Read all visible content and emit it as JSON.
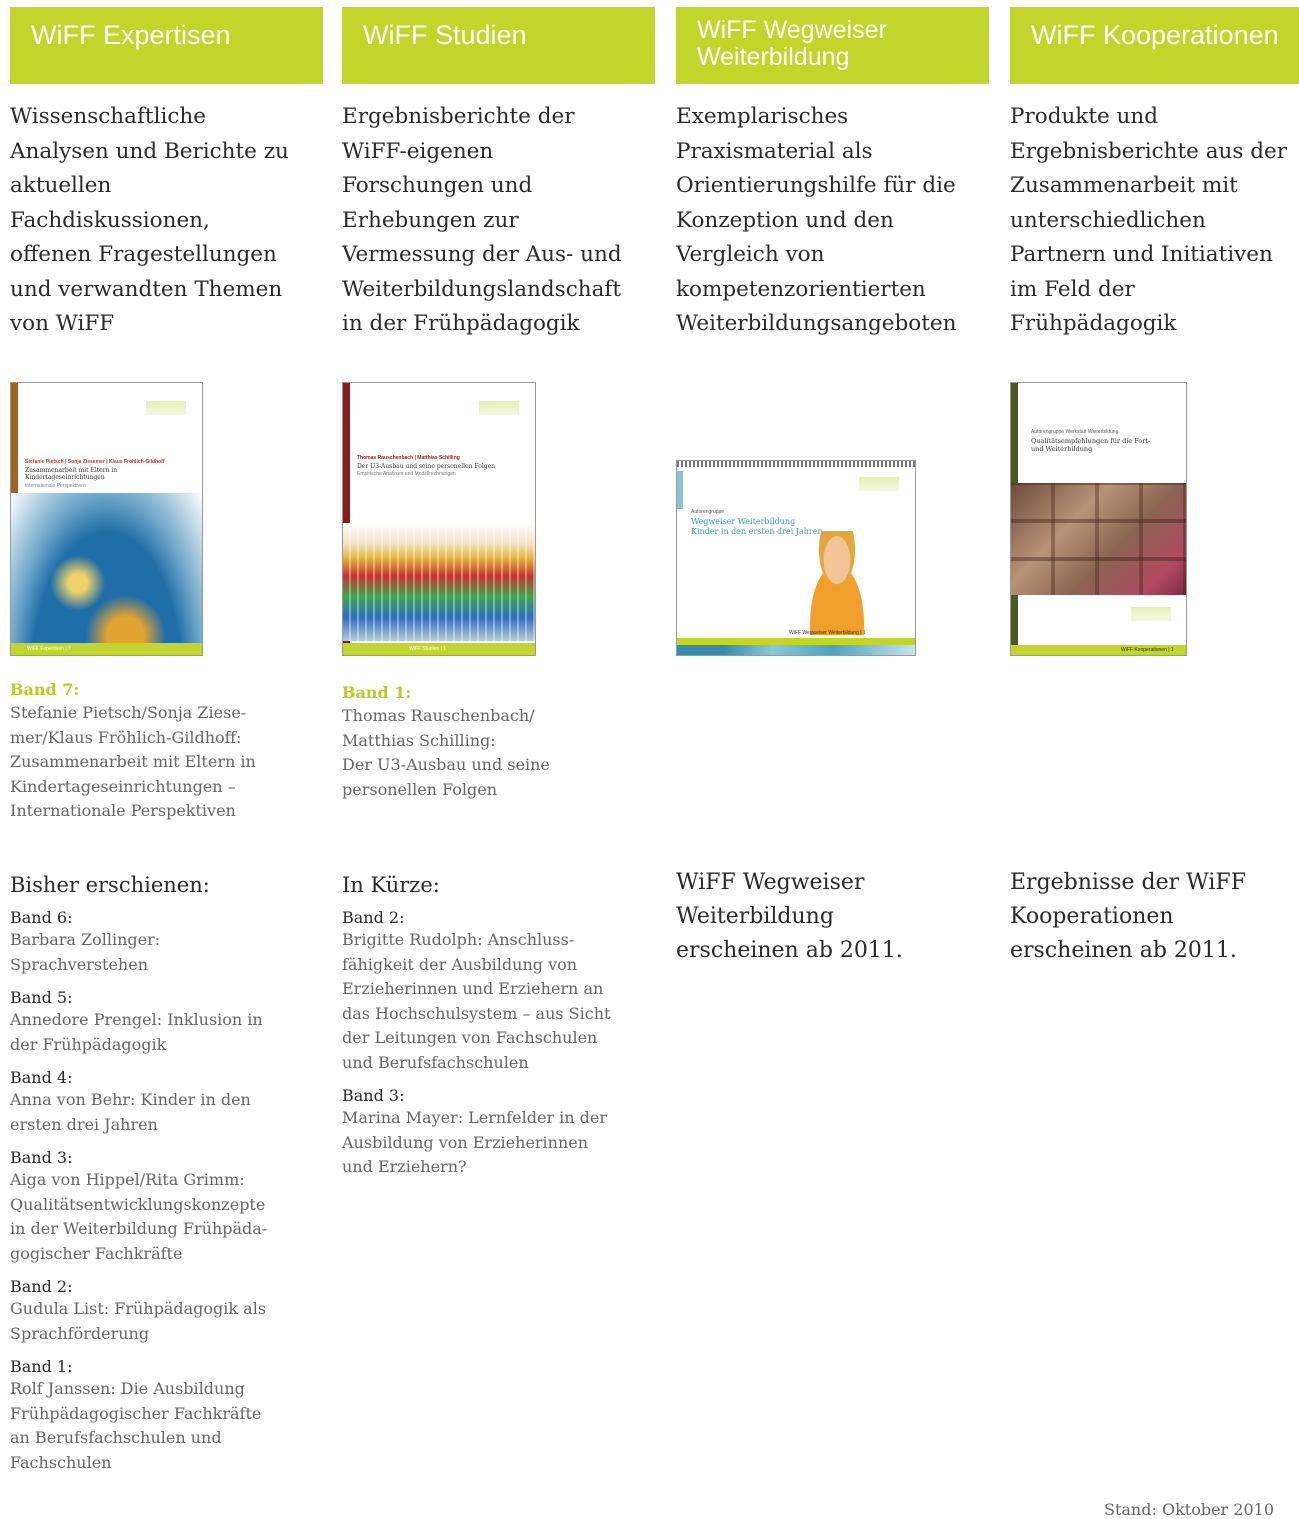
{
  "columns": [
    {
      "header": "WiFF Expertisen",
      "intro": "Wissenschaftliche Analysen und Berichte zu aktuellen Fachdiskussionen, offenen Fragestellungen und verwandten Themen von WiFF",
      "cover": {
        "authors": "Stefanie Pietsch | Sonja Ziesemer | Klaus Fröhlich-Gildhoff",
        "title": "Zusammenarbeit mit Eltern in Kindertageseinrichtungen",
        "subtitle": "Internationale Perspektiven",
        "footer": "WiFF Expertisen | 7"
      },
      "featured": {
        "band": "Band 7:",
        "lines": [
          "Stefanie Pietsch/Sonja Ziese-",
          "mer/Klaus Fröhlich-Gildhoff:",
          "Zusammenarbeit mit Eltern in",
          "Kindertageseinrichtungen –",
          "Internationale Perspektiven"
        ]
      },
      "section_title": "Bisher erschienen:",
      "list": [
        {
          "band": "Band 6:",
          "lines": [
            "Barbara Zollinger:",
            "Sprachverstehen"
          ]
        },
        {
          "band": "Band 5:",
          "lines": [
            "Annedore Prengel: Inklusion in",
            "der Frühpädagogik"
          ]
        },
        {
          "band": "Band 4:",
          "lines": [
            "Anna von Behr: Kinder in den",
            "ersten drei Jahren"
          ]
        },
        {
          "band": "Band 3:",
          "lines": [
            "Aiga von Hippel/Rita Grimm:",
            "Qualitätsentwicklungskonzepte",
            "in der Weiterbildung Frühpäda-",
            "gogischer Fachkräfte"
          ]
        },
        {
          "band": "Band 2:",
          "lines": [
            "Gudula List: Frühpädagogik als",
            "Sprachförderung"
          ]
        },
        {
          "band": "Band 1:",
          "lines": [
            "Rolf Janssen: Die Ausbildung",
            "Frühpädagogischer Fachkräfte",
            "an Berufsfachschulen und",
            "Fachschulen"
          ]
        }
      ]
    },
    {
      "header": "WiFF Studien",
      "intro": "Ergebnisberichte der WiFF-eigenen Forschungen und Erhebungen zur Vermessung der Aus- und Weiterbildungslandschaft in der Frühpädagogik",
      "cover": {
        "authors": "Thomas Rauschenbach | Matthias Schilling",
        "title": "Der U3-Ausbau und seine personellen Folgen",
        "subtitle": "Empirische Analysen und Modellrechnungen",
        "footer": "WiFF Studien | 1"
      },
      "featured": {
        "band": "Band 1:",
        "lines": [
          "Thomas Rauschenbach/",
          "Matthias Schilling:",
          "Der U3-Ausbau und seine",
          "personellen Folgen"
        ]
      },
      "section_title": "In Kürze:",
      "list": [
        {
          "band": "Band 2:",
          "lines": [
            "Brigitte Rudolph: Anschluss-",
            "fähigkeit der Ausbildung von",
            "Erzieherinnen und Erziehern an",
            "das Hochschulsystem – aus Sicht",
            "der Leitungen von Fachschulen",
            "und Berufsfachschulen"
          ]
        },
        {
          "band": "Band 3:",
          "lines": [
            "Marina Mayer: Lernfelder in der",
            "Ausbildung von Erzieherinnen",
            "und Erziehern?"
          ]
        }
      ]
    },
    {
      "header": "WiFF Wegweiser Weiterbildung",
      "intro": "Exemplarisches Praxismaterial als Orientierungshilfe für die Konzeption und den Vergleich von kompetenzorientierten Weiterbildungsangeboten",
      "cover": {
        "authors": "Autorengruppe",
        "title": "Wegweiser Weiterbildung",
        "subtitle": "Kinder in den ersten drei Jahren",
        "footer": "WiFF Wegweiser Weiterbildung | 1"
      },
      "soon": [
        "WiFF Wegweiser",
        "Weiterbildung",
        "erscheinen ab 2011."
      ]
    },
    {
      "header": "WiFF Kooperationen",
      "intro": "Produkte und Ergebnisberichte aus der Zusammenarbeit mit unterschiedlichen Partnern und Initiativen im Feld der Frühpädagogik",
      "cover": {
        "authors": "Autorengruppe Werkstatt Weiterbildung",
        "title": "Qualitätsempfehlungen für die Fort- und Weiterbildung",
        "footer": "WiFF Kooperationen | 1"
      },
      "soon": [
        "Ergebnisse der WiFF",
        "Kooperationen",
        "erscheinen ab 2011."
      ]
    }
  ],
  "stand": "Stand: Oktober 2010",
  "colors": {
    "accent": "#c2d52b",
    "band_label": "#b8cc22"
  }
}
